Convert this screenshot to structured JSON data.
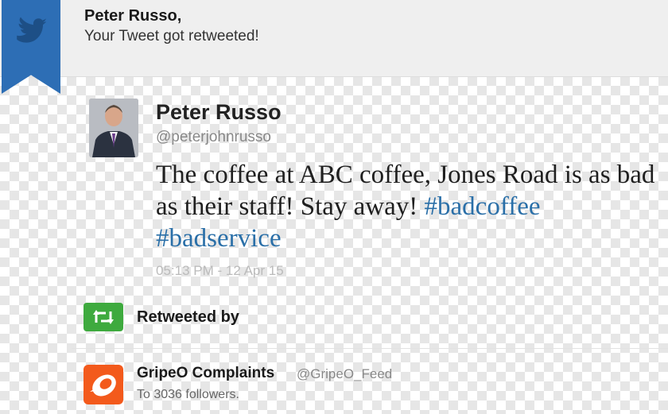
{
  "notification": {
    "name": "Peter Russo,",
    "message": "Your Tweet got retweeted!"
  },
  "tweet": {
    "author_name": "Peter Russo",
    "author_handle": "@peterjohnrusso",
    "text_plain": "The coffee at ABC coffee, Jones Road is as bad as their staff! Stay away! ",
    "hashtag1": "#badcoffee",
    "hashtag2": "#badservice",
    "timestamp": "05:13 PM - 12 Apr 15"
  },
  "retweet": {
    "label": "Retweeted by",
    "account_name": "GripeO Complaints",
    "account_handle": "@GripeO_Feed",
    "followers_text": "To 3036 followers."
  },
  "colors": {
    "ribbon": "#2d6eb5",
    "hashtag": "#2a6fa8",
    "retweet_icon": "#3eaa3e",
    "gripe_icon": "#f35a1c"
  },
  "icons": {
    "ribbon": "twitter-bird-icon",
    "retweet": "retweet-icon",
    "account": "gripeo-logo-icon"
  }
}
